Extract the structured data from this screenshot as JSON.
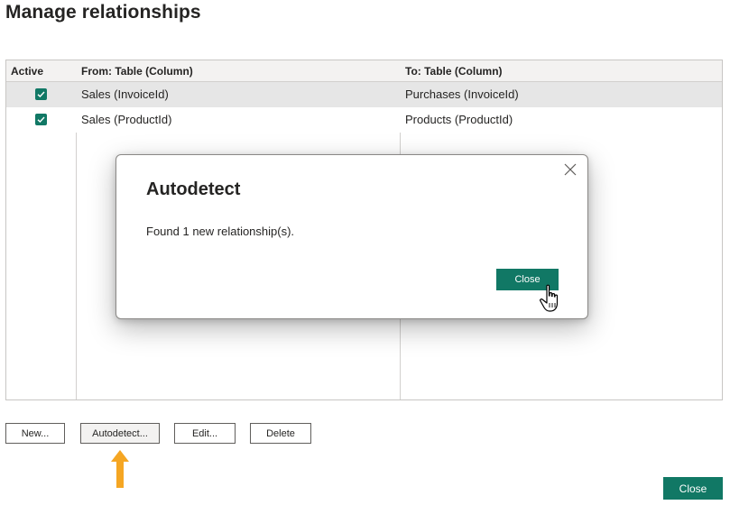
{
  "page": {
    "title": "Manage relationships"
  },
  "table": {
    "headers": [
      "Active",
      "From: Table (Column)",
      "To: Table (Column)"
    ],
    "rows": [
      {
        "active": true,
        "from": "Sales (InvoiceId)",
        "to": "Purchases (InvoiceId)"
      },
      {
        "active": true,
        "from": "Sales (ProductId)",
        "to": "Products (ProductId)"
      }
    ]
  },
  "buttons": {
    "new": "New...",
    "autodetect": "Autodetect...",
    "edit": "Edit...",
    "delete": "Delete",
    "close": "Close"
  },
  "dialog": {
    "title": "Autodetect",
    "message": "Found 1 new relationship(s).",
    "close_button": "Close"
  },
  "colors": {
    "accent": "#117865",
    "arrow": "#f5a623"
  },
  "icons": {
    "checkbox": "check-icon",
    "dialog_close": "close-icon",
    "pointer": "hand-cursor-icon",
    "highlight_arrow": "up-arrow-icon"
  }
}
